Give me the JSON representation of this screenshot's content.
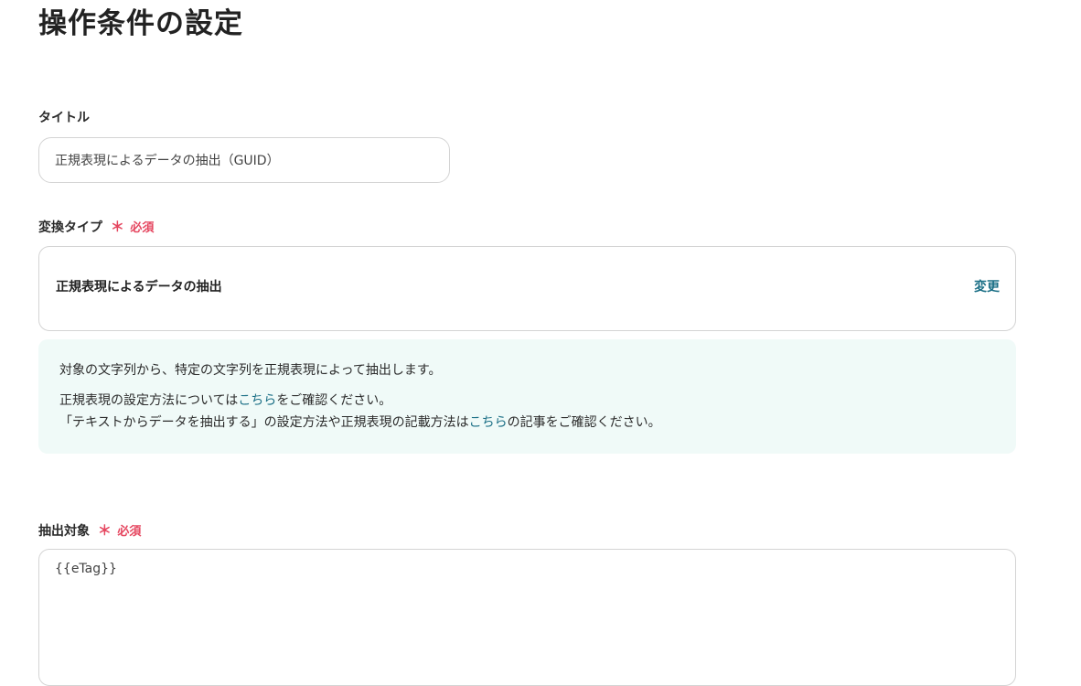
{
  "page": {
    "title": "操作条件の設定"
  },
  "title_field": {
    "label": "タイトル",
    "value": "正規表現によるデータの抽出（GUID）"
  },
  "conversion_type": {
    "label": "変換タイプ",
    "required_mark": "＊",
    "required_text": "必須",
    "selected": "正規表現によるデータの抽出",
    "change_label": "変更"
  },
  "info": {
    "line1": "対象の文字列から、特定の文字列を正規表現によって抽出します。",
    "line2_before": "正規表現の設定方法については",
    "line2_link": "こちら",
    "line2_after": "をご確認ください。",
    "line3_before": "「テキストからデータを抽出する」の設定方法や正規表現の記載方法は",
    "line3_link": "こちら",
    "line3_after": "の記事をご確認ください。"
  },
  "extract_target": {
    "label": "抽出対象",
    "required_mark": "＊",
    "required_text": "必須",
    "value": "{{eTag}}"
  },
  "colors": {
    "required": "#e5465f",
    "link": "#1b6f86",
    "info_background": "#f0faf8",
    "border": "#d4d4d4"
  }
}
